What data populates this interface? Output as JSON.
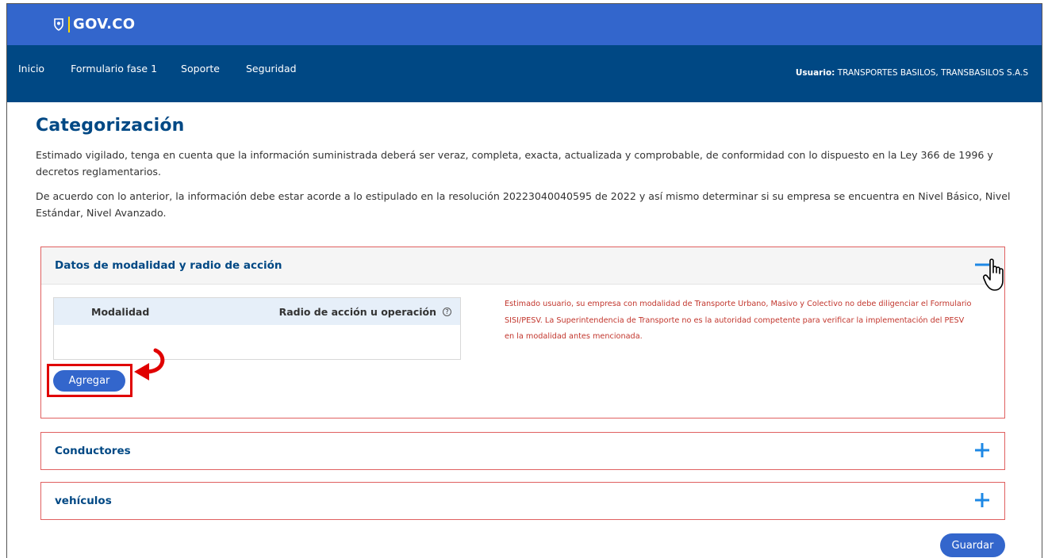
{
  "gov_bar": {
    "logo_text": "GOV.CO"
  },
  "nav": {
    "items": [
      "Inicio",
      "Formulario fase 1",
      "Soporte",
      "Seguridad"
    ],
    "user_label": "Usuario:",
    "user_name": "TRANSPORTES BASILOS, TRANSBASILOS S.A.S"
  },
  "page": {
    "title": "Categorización",
    "paragraph_1": "Estimado vigilado, tenga en cuenta que la información suministrada deberá ser veraz, completa, exacta, actualizada y comprobable, de conformidad con lo dispuesto en la Ley 366 de 1996 y decretos reglamentarios.",
    "paragraph_2": "De acuerdo con lo anterior, la información debe estar acorde a lo estipulado en la resolución 20223040040595 de 2022 y así mismo determinar si su empresa se encuentra en Nivel Básico, Nivel Estándar, Nivel Avanzado."
  },
  "sections": {
    "modalidad": {
      "title": "Datos de modalidad y radio de acción",
      "state": "expanded",
      "table_headers": [
        "Modalidad",
        "Radio de acción u operación"
      ],
      "help_glyph": "?",
      "notice": "Estimado usuario, su empresa con modalidad de Transporte Urbano, Masivo y Colectivo no debe diligenciar el Formulario SISI/PESV. La Superintendencia de Transporte no es la autoridad competente para verificar la implementación del PESV en la modalidad antes mencionada.",
      "add_button": "Agregar"
    },
    "conductores": {
      "title": "Conductores",
      "state": "collapsed"
    },
    "vehiculos": {
      "title": "vehículos",
      "state": "collapsed"
    }
  },
  "actions": {
    "save_button": "Guardar"
  },
  "colors": {
    "gov_blue": "#3366cc",
    "nav_blue": "#004884",
    "accent_blue": "#3366cc",
    "icon_blue": "#1e88e5",
    "notice_red": "#c2362d",
    "highlight_red": "#e00000"
  },
  "icons": {
    "logo": "colombia-shield-icon",
    "collapse": "minus-icon",
    "expand": "plus-icon",
    "help": "help-circle-icon",
    "pointer": "hand-pointer-cursor",
    "annotation": "curved-arrow-icon"
  }
}
